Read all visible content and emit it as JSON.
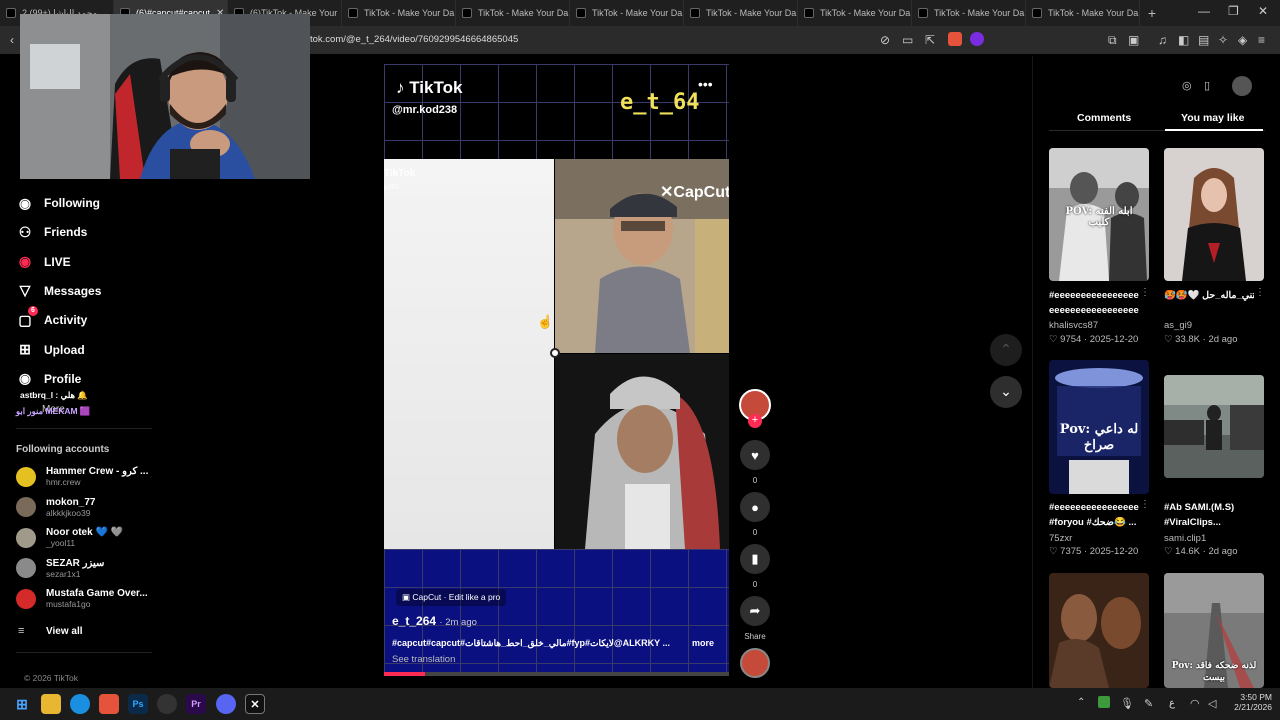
{
  "browser": {
    "tabs": [
      {
        "label": "محمد الباشا (+99) 2"
      },
      {
        "label": "(6)#capcut#capcut",
        "active": true
      },
      {
        "label": "(6)TikTok - Make Your"
      },
      {
        "label": "TikTok - Make Your Da"
      },
      {
        "label": "TikTok - Make Your Da"
      },
      {
        "label": "TikTok - Make Your Da"
      },
      {
        "label": "TikTok - Make Your Da"
      },
      {
        "label": "TikTok - Make Your Da"
      },
      {
        "label": "TikTok - Make Your Da"
      },
      {
        "label": "TikTok - Make Your Da"
      }
    ],
    "url": "tok.com/@e_t_264/video/7609299546664865045"
  },
  "sidebar": {
    "nav": [
      {
        "label": "Following",
        "icon": "avatar-icon"
      },
      {
        "label": "Friends",
        "icon": "friends-icon"
      },
      {
        "label": "LIVE",
        "icon": "live-icon"
      },
      {
        "label": "Messages",
        "icon": "send-icon"
      },
      {
        "label": "Activity",
        "icon": "activity-icon",
        "badge": "6"
      },
      {
        "label": "Upload",
        "icon": "plus-square-icon"
      },
      {
        "label": "Profile",
        "icon": "avatar-icon"
      }
    ],
    "overlay_lines": [
      "astbrq_l : هلي 🔔",
      "منور ابو MEKAM 🟪"
    ],
    "more_label": "More",
    "following_header": "Following accounts",
    "accounts": [
      {
        "name": "Hammer Crew - كرو ...",
        "handle": "hmr.crew",
        "color": "#e5c021"
      },
      {
        "name": "mokon_77",
        "handle": "alkkkjkoo39",
        "color": "#7a6a5a"
      },
      {
        "name": "Noor otek 💙 🩶",
        "handle": "_yool11",
        "color": "#a09a8a"
      },
      {
        "name": "SEZAR سيزر",
        "handle": "sezar1x1",
        "color": "#8a8a8a"
      },
      {
        "name": "Mustafa Game Over...",
        "handle": "mustafa1go",
        "color": "#d42a2a"
      }
    ],
    "view_all": "View all",
    "copyright": "© 2026 TikTok"
  },
  "video": {
    "watermark_brand": "TikTok",
    "watermark_handle": "@mr.kod238",
    "overlay_name": "e_t_64",
    "inner_brand": "TikTok",
    "inner_sub": "p362",
    "capcut_logo": "CapCut",
    "capcut_badge": "CapCut · Edit like a pro",
    "author": "e_t_264",
    "posted": "· 2m ago",
    "caption": "#capcut#capcut#مالي_خلق_احط_هاشتاقات#fyp#لايكات@ALKRKY ...",
    "more_label": "more",
    "see_translation": "See translation",
    "progress": 0.12
  },
  "actions": {
    "like_count": "0",
    "comment_count": "0",
    "save_count": "0",
    "share_label": "Share"
  },
  "panel": {
    "tabs": [
      "Comments",
      "You may like"
    ],
    "active_tab": "You may like",
    "cards": [
      {
        "thumb_text": "POV: ابله الفنه كليب",
        "title": "#eeeeeeeeeeeeeeeeeeeeee...",
        "title2": "eeeeeeeeeeeeeeeeeeeeeee...",
        "user": "khalisvcs87",
        "likes": "9754",
        "date": "2025-12-20"
      },
      {
        "thumb_text": "",
        "title": "🥵🥵🤍 حب_المستني_ماله_حل...",
        "title2": "",
        "user": "as_gi9",
        "likes": "33.8K",
        "date": "2d ago"
      },
      {
        "thumb_text": "Pov: له داعي صراخ",
        "title": "#eeeeeeeeeeeeeeeeeeeeee",
        "title2": "#foryou #ضحك😂 ...",
        "user": "75zxr",
        "likes": "7375",
        "date": "2025-12-20"
      },
      {
        "thumb_text": "",
        "title": "#Ab SAMI.(M.S)",
        "title2": "#ViralClips...",
        "user": "sami.clip1",
        "likes": "14.6K",
        "date": "2d ago"
      },
      {
        "thumb_text": "",
        "title": "",
        "title2": "",
        "user": "",
        "likes": "",
        "date": ""
      },
      {
        "thumb_text": "Pov: لذنه ضحكه فاقد بيست",
        "title": "",
        "title2": "",
        "user": "",
        "likes": "",
        "date": ""
      }
    ]
  },
  "taskbar": {
    "time": "3:50 PM",
    "date": "2/21/2026",
    "lang": "ع",
    "apps": [
      "windows-icon",
      "file-explorer-icon",
      "edge-icon",
      "brave-icon",
      "photoshop-icon",
      "obs-icon",
      "premiere-icon",
      "discord-icon",
      "capcut-icon"
    ],
    "labels": {
      "ps": "Ps",
      "pr": "Pr"
    }
  },
  "colors": {
    "accent": "#fe2c55",
    "panel_bg": "#000000"
  }
}
